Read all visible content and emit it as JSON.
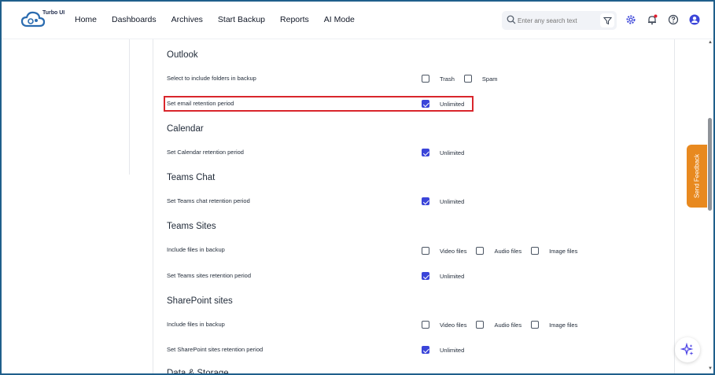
{
  "app": {
    "logo_text": "Turbo UI"
  },
  "nav": {
    "items": [
      "Home",
      "Dashboards",
      "Archives",
      "Start Backup",
      "Reports",
      "AI Mode"
    ]
  },
  "search": {
    "placeholder": "Enter any search text"
  },
  "icons": {
    "filter": "filter-icon",
    "settings": "gear-icon",
    "notifications": "bell-icon",
    "help": "help-icon",
    "profile": "user-icon",
    "ai": "sparkle-icon"
  },
  "colors": {
    "accent": "#3b45d9",
    "highlight": "#d9262c",
    "feedback": "#e8891f"
  },
  "feedback_label": "Send Feedback",
  "sections": {
    "outlook": {
      "title": "Outlook",
      "folders_label": "Select to include folders in backup",
      "folders_options": [
        {
          "label": "Trash",
          "checked": false
        },
        {
          "label": "Spam",
          "checked": false
        }
      ],
      "retention_label": "Set email retention period",
      "retention_option": {
        "label": "Unlimited",
        "checked": true
      }
    },
    "calendar": {
      "title": "Calendar",
      "retention_label": "Set Calendar retention period",
      "retention_option": {
        "label": "Unlimited",
        "checked": true
      }
    },
    "teams_chat": {
      "title": "Teams Chat",
      "retention_label": "Set Teams chat retention period",
      "retention_option": {
        "label": "Unlimited",
        "checked": true
      }
    },
    "teams_sites": {
      "title": "Teams Sites",
      "files_label": "Include files in backup",
      "files_options": [
        {
          "label": "Video files",
          "checked": false
        },
        {
          "label": "Audio files",
          "checked": false
        },
        {
          "label": "Image files",
          "checked": false
        }
      ],
      "retention_label": "Set Teams sites retention period",
      "retention_option": {
        "label": "Unlimited",
        "checked": true
      }
    },
    "sharepoint": {
      "title": "SharePoint sites",
      "files_label": "Include files in backup",
      "files_options": [
        {
          "label": "Video files",
          "checked": false
        },
        {
          "label": "Audio files",
          "checked": false
        },
        {
          "label": "Image files",
          "checked": false
        }
      ],
      "retention_label": "Set SharePoint sites retention period",
      "retention_option": {
        "label": "Unlimited",
        "checked": true
      }
    },
    "data_storage": {
      "title": "Data & Storage"
    }
  }
}
